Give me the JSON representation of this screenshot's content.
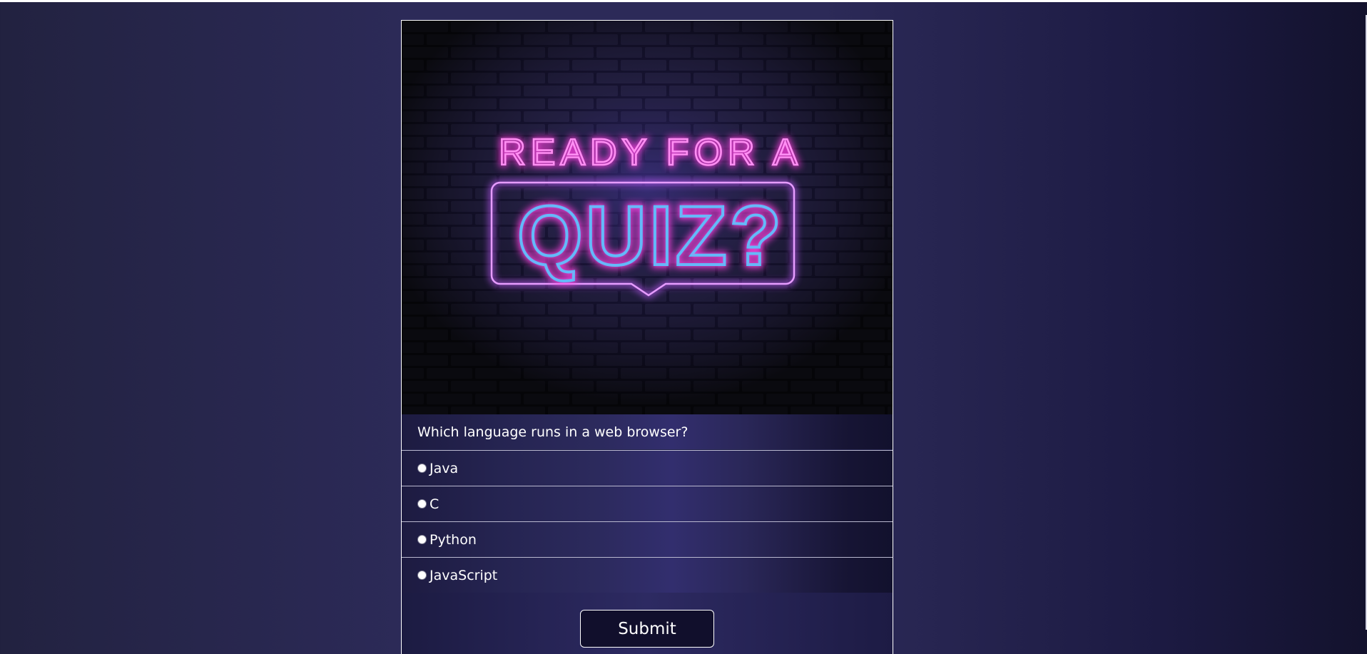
{
  "hero": {
    "line1": "READY FOR A",
    "line2": "QUIZ?"
  },
  "quiz": {
    "question": "Which language runs in a web browser?",
    "options": [
      "Java",
      "C",
      "Python",
      "JavaScript"
    ],
    "submit_label": "Submit"
  },
  "colors": {
    "neon_pink": "#ff3fe0",
    "neon_cyan": "#33d6ff",
    "neon_violet": "#b44cff"
  }
}
